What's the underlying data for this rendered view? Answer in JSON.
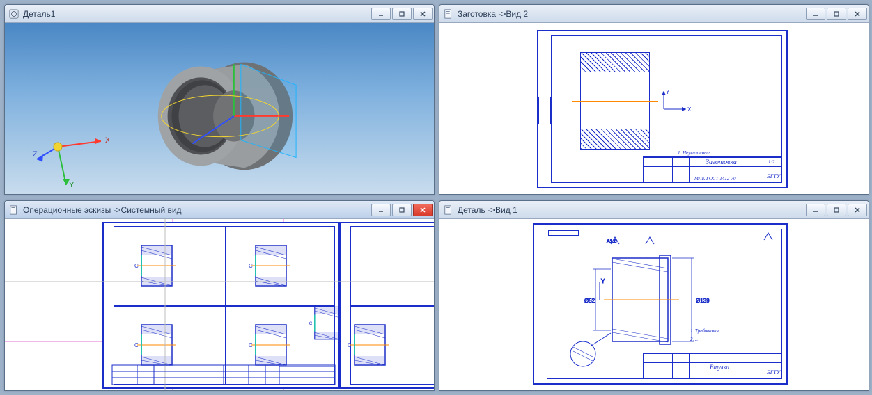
{
  "windows": {
    "tl": {
      "title": "Деталь1"
    },
    "tr": {
      "title": "Заготовка  ->Вид 2"
    },
    "bl": {
      "title": "Операционные эскизы ->Системный вид"
    },
    "br": {
      "title": "Деталь ->Вид 1"
    }
  },
  "axes": {
    "x": "X",
    "y": "Y",
    "z": "Z"
  },
  "coord": {
    "x": "X",
    "y": "Y"
  },
  "stamp": {
    "zagotovka": "Заготовка",
    "vtulka": "Втулка",
    "bgtu": "БГТУ",
    "gost": "МЛК ГОСТ 1412-70",
    "mass_label": "1:2"
  },
  "notes": {
    "tr": "1. Неуказанные…",
    "br1": "1. Требования…",
    "br2": "2. …"
  },
  "dims": {
    "d1": "Ø139",
    "d2": "Ø52",
    "d3": "A1.8"
  }
}
